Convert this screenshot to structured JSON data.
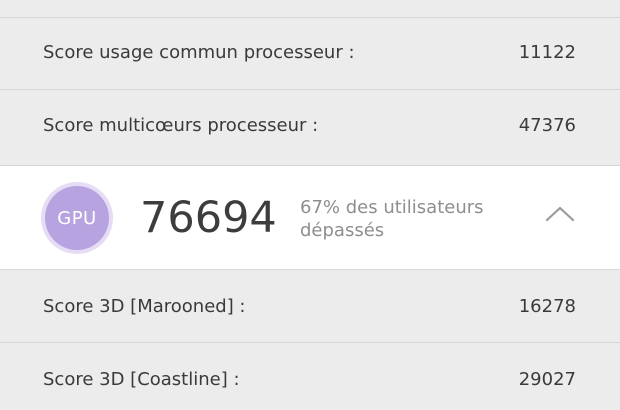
{
  "cpu_scores": [
    {
      "label": "Score usage commun processeur :",
      "value": "11122"
    },
    {
      "label": "Score multicœurs processeur :",
      "value": "47376"
    }
  ],
  "gpu_section": {
    "badge_label": "GPU",
    "score": "76694",
    "percentile_line1": "67% des utilisateurs",
    "percentile_line2": "dépassés",
    "badge_color": "#b7a3df",
    "expand_icon": "chevron-up-icon"
  },
  "gpu_scores": [
    {
      "label": "Score 3D [Marooned] :",
      "value": "16278"
    },
    {
      "label": "Score 3D [Coastline] :",
      "value": "29027"
    }
  ]
}
